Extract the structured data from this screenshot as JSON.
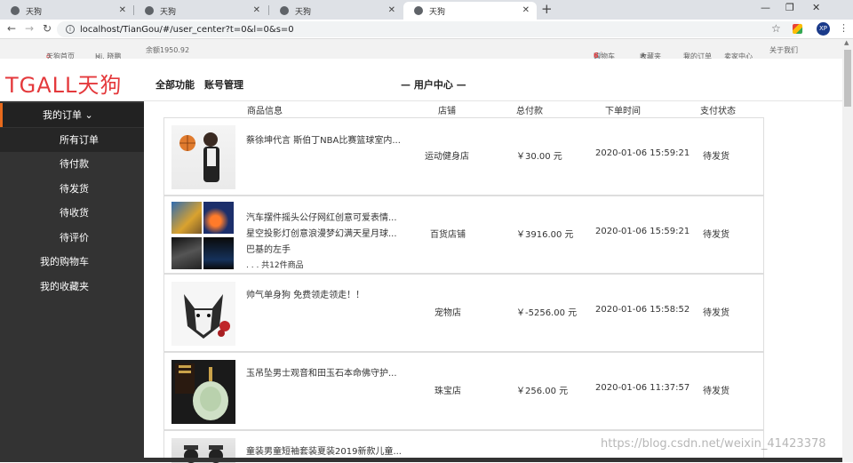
{
  "browser": {
    "tabs": [
      {
        "title": "天狗"
      },
      {
        "title": "天狗"
      },
      {
        "title": "天狗"
      },
      {
        "title": "天狗"
      }
    ],
    "url": "localhost/TianGou/#/user_center?t=0&l=0&s=0",
    "profile_initials": "XP"
  },
  "topbar": {
    "home": "天狗首页",
    "greeting": "Hi, 晓鹏",
    "balance": "余额1950.92",
    "cart_label": "购物车",
    "cart_count": "6",
    "favorites": "收藏夹",
    "my_orders": "我的订单",
    "seller_center": "卖家中心",
    "about": "关于我们"
  },
  "header": {
    "logo": "TGALL天狗",
    "nav_all": "全部功能",
    "nav_account": "账号管理",
    "center_title": "— 用户中心 —"
  },
  "sidebar": {
    "my_orders": "我的订单",
    "sub": [
      "所有订单",
      "待付款",
      "待发货",
      "待收货",
      "待评价"
    ],
    "my_cart": "我的购物车",
    "my_favorites": "我的收藏夹"
  },
  "table": {
    "headers": [
      "商品信息",
      "店铺",
      "总付款",
      "下单时间",
      "支付状态"
    ]
  },
  "orders": [
    {
      "products": [
        "蔡徐坤代言 斯伯丁NBA比赛篮球室内..."
      ],
      "shop": "运动健身店",
      "total": "￥30.00 元",
      "time": "2020-01-06 15:59:21",
      "status": "待发货"
    },
    {
      "products": [
        "汽车摆件摇头公仔网红创意可爱表情...",
        "星空投影灯创意浪漫梦幻满天星月球...",
        "巴基的左手",
        ". . . 共12件商品"
      ],
      "shop": "百货店铺",
      "total": "￥3916.00 元",
      "time": "2020-01-06 15:59:21",
      "status": "待发货"
    },
    {
      "products": [
        "帅气单身狗 免费领走领走！！"
      ],
      "shop": "宠物店",
      "total": "￥-5256.00 元",
      "time": "2020-01-06 15:58:52",
      "status": "待发货"
    },
    {
      "products": [
        "玉吊坠男士观音和田玉石本命佛守护..."
      ],
      "shop": "珠宝店",
      "total": "￥256.00 元",
      "time": "2020-01-06 11:37:57",
      "status": "待发货"
    },
    {
      "products": [
        "童装男童短袖套装夏装2019新款儿童..."
      ]
    }
  ],
  "watermark": "https://blog.csdn.net/weixin_41423378",
  "colors": {
    "brand": "#e4393c",
    "sidebar_bg": "#333333",
    "active_accent": "#e86a1c"
  }
}
